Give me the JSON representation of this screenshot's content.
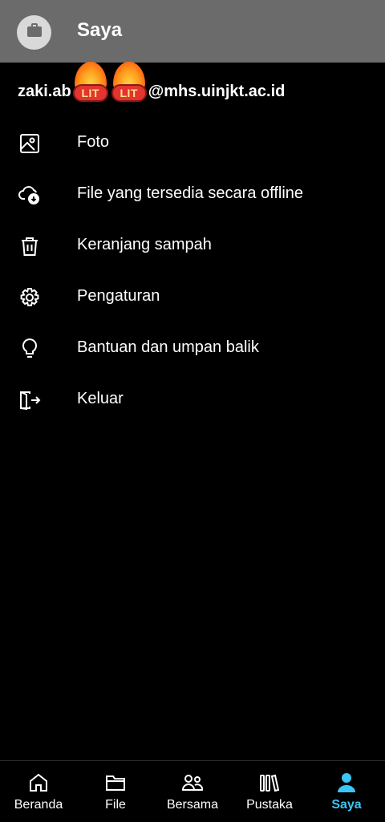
{
  "header": {
    "title": "Saya",
    "avatar_icon": "briefcase-icon"
  },
  "account": {
    "email_prefix": "zaki.ab",
    "email_suffix": "@mhs.uinjkt.ac.id",
    "emoji_badges": [
      {
        "text": "LIT",
        "icon": "fire-emoji"
      },
      {
        "text": "LIT",
        "icon": "fire-emoji"
      }
    ]
  },
  "menu": {
    "items": [
      {
        "label": "Foto",
        "icon": "photo-icon"
      },
      {
        "label": "File yang tersedia secara offline",
        "icon": "cloud-download-icon"
      },
      {
        "label": "Keranjang sampah",
        "icon": "trash-icon"
      },
      {
        "label": "Pengaturan",
        "icon": "gear-icon"
      },
      {
        "label": "Bantuan dan umpan balik",
        "icon": "lightbulb-icon"
      },
      {
        "label": "Keluar",
        "icon": "sign-out-icon"
      }
    ]
  },
  "bottom_nav": {
    "items": [
      {
        "label": "Beranda",
        "icon": "home-icon",
        "active": false
      },
      {
        "label": "File",
        "icon": "folder-icon",
        "active": false
      },
      {
        "label": "Bersama",
        "icon": "people-icon",
        "active": false
      },
      {
        "label": "Pustaka",
        "icon": "library-icon",
        "active": false
      },
      {
        "label": "Saya",
        "icon": "person-icon",
        "active": true
      }
    ]
  },
  "colors": {
    "header_bg": "#6b6b6b",
    "background": "#000000",
    "active_accent": "#3cc6f5"
  }
}
